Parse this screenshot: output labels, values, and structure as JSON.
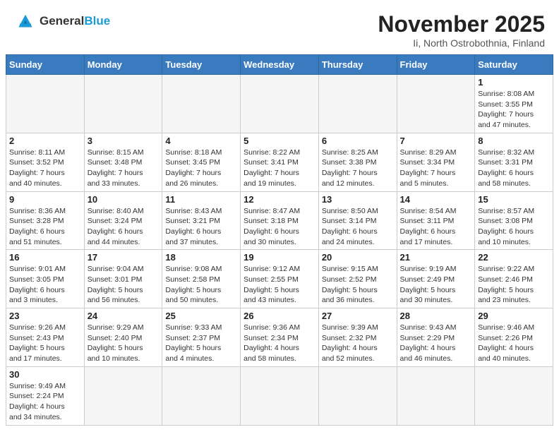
{
  "header": {
    "logo_general": "General",
    "logo_blue": "Blue",
    "month_title": "November 2025",
    "subtitle": "Ii, North Ostrobothnia, Finland"
  },
  "weekdays": [
    "Sunday",
    "Monday",
    "Tuesday",
    "Wednesday",
    "Thursday",
    "Friday",
    "Saturday"
  ],
  "weeks": [
    [
      {
        "day": "",
        "info": ""
      },
      {
        "day": "",
        "info": ""
      },
      {
        "day": "",
        "info": ""
      },
      {
        "day": "",
        "info": ""
      },
      {
        "day": "",
        "info": ""
      },
      {
        "day": "",
        "info": ""
      },
      {
        "day": "1",
        "info": "Sunrise: 8:08 AM\nSunset: 3:55 PM\nDaylight: 7 hours\nand 47 minutes."
      }
    ],
    [
      {
        "day": "2",
        "info": "Sunrise: 8:11 AM\nSunset: 3:52 PM\nDaylight: 7 hours\nand 40 minutes."
      },
      {
        "day": "3",
        "info": "Sunrise: 8:15 AM\nSunset: 3:48 PM\nDaylight: 7 hours\nand 33 minutes."
      },
      {
        "day": "4",
        "info": "Sunrise: 8:18 AM\nSunset: 3:45 PM\nDaylight: 7 hours\nand 26 minutes."
      },
      {
        "day": "5",
        "info": "Sunrise: 8:22 AM\nSunset: 3:41 PM\nDaylight: 7 hours\nand 19 minutes."
      },
      {
        "day": "6",
        "info": "Sunrise: 8:25 AM\nSunset: 3:38 PM\nDaylight: 7 hours\nand 12 minutes."
      },
      {
        "day": "7",
        "info": "Sunrise: 8:29 AM\nSunset: 3:34 PM\nDaylight: 7 hours\nand 5 minutes."
      },
      {
        "day": "8",
        "info": "Sunrise: 8:32 AM\nSunset: 3:31 PM\nDaylight: 6 hours\nand 58 minutes."
      }
    ],
    [
      {
        "day": "9",
        "info": "Sunrise: 8:36 AM\nSunset: 3:28 PM\nDaylight: 6 hours\nand 51 minutes."
      },
      {
        "day": "10",
        "info": "Sunrise: 8:40 AM\nSunset: 3:24 PM\nDaylight: 6 hours\nand 44 minutes."
      },
      {
        "day": "11",
        "info": "Sunrise: 8:43 AM\nSunset: 3:21 PM\nDaylight: 6 hours\nand 37 minutes."
      },
      {
        "day": "12",
        "info": "Sunrise: 8:47 AM\nSunset: 3:18 PM\nDaylight: 6 hours\nand 30 minutes."
      },
      {
        "day": "13",
        "info": "Sunrise: 8:50 AM\nSunset: 3:14 PM\nDaylight: 6 hours\nand 24 minutes."
      },
      {
        "day": "14",
        "info": "Sunrise: 8:54 AM\nSunset: 3:11 PM\nDaylight: 6 hours\nand 17 minutes."
      },
      {
        "day": "15",
        "info": "Sunrise: 8:57 AM\nSunset: 3:08 PM\nDaylight: 6 hours\nand 10 minutes."
      }
    ],
    [
      {
        "day": "16",
        "info": "Sunrise: 9:01 AM\nSunset: 3:05 PM\nDaylight: 6 hours\nand 3 minutes."
      },
      {
        "day": "17",
        "info": "Sunrise: 9:04 AM\nSunset: 3:01 PM\nDaylight: 5 hours\nand 56 minutes."
      },
      {
        "day": "18",
        "info": "Sunrise: 9:08 AM\nSunset: 2:58 PM\nDaylight: 5 hours\nand 50 minutes."
      },
      {
        "day": "19",
        "info": "Sunrise: 9:12 AM\nSunset: 2:55 PM\nDaylight: 5 hours\nand 43 minutes."
      },
      {
        "day": "20",
        "info": "Sunrise: 9:15 AM\nSunset: 2:52 PM\nDaylight: 5 hours\nand 36 minutes."
      },
      {
        "day": "21",
        "info": "Sunrise: 9:19 AM\nSunset: 2:49 PM\nDaylight: 5 hours\nand 30 minutes."
      },
      {
        "day": "22",
        "info": "Sunrise: 9:22 AM\nSunset: 2:46 PM\nDaylight: 5 hours\nand 23 minutes."
      }
    ],
    [
      {
        "day": "23",
        "info": "Sunrise: 9:26 AM\nSunset: 2:43 PM\nDaylight: 5 hours\nand 17 minutes."
      },
      {
        "day": "24",
        "info": "Sunrise: 9:29 AM\nSunset: 2:40 PM\nDaylight: 5 hours\nand 10 minutes."
      },
      {
        "day": "25",
        "info": "Sunrise: 9:33 AM\nSunset: 2:37 PM\nDaylight: 5 hours\nand 4 minutes."
      },
      {
        "day": "26",
        "info": "Sunrise: 9:36 AM\nSunset: 2:34 PM\nDaylight: 4 hours\nand 58 minutes."
      },
      {
        "day": "27",
        "info": "Sunrise: 9:39 AM\nSunset: 2:32 PM\nDaylight: 4 hours\nand 52 minutes."
      },
      {
        "day": "28",
        "info": "Sunrise: 9:43 AM\nSunset: 2:29 PM\nDaylight: 4 hours\nand 46 minutes."
      },
      {
        "day": "29",
        "info": "Sunrise: 9:46 AM\nSunset: 2:26 PM\nDaylight: 4 hours\nand 40 minutes."
      }
    ],
    [
      {
        "day": "30",
        "info": "Sunrise: 9:49 AM\nSunset: 2:24 PM\nDaylight: 4 hours\nand 34 minutes."
      },
      {
        "day": "",
        "info": ""
      },
      {
        "day": "",
        "info": ""
      },
      {
        "day": "",
        "info": ""
      },
      {
        "day": "",
        "info": ""
      },
      {
        "day": "",
        "info": ""
      },
      {
        "day": "",
        "info": ""
      }
    ]
  ]
}
